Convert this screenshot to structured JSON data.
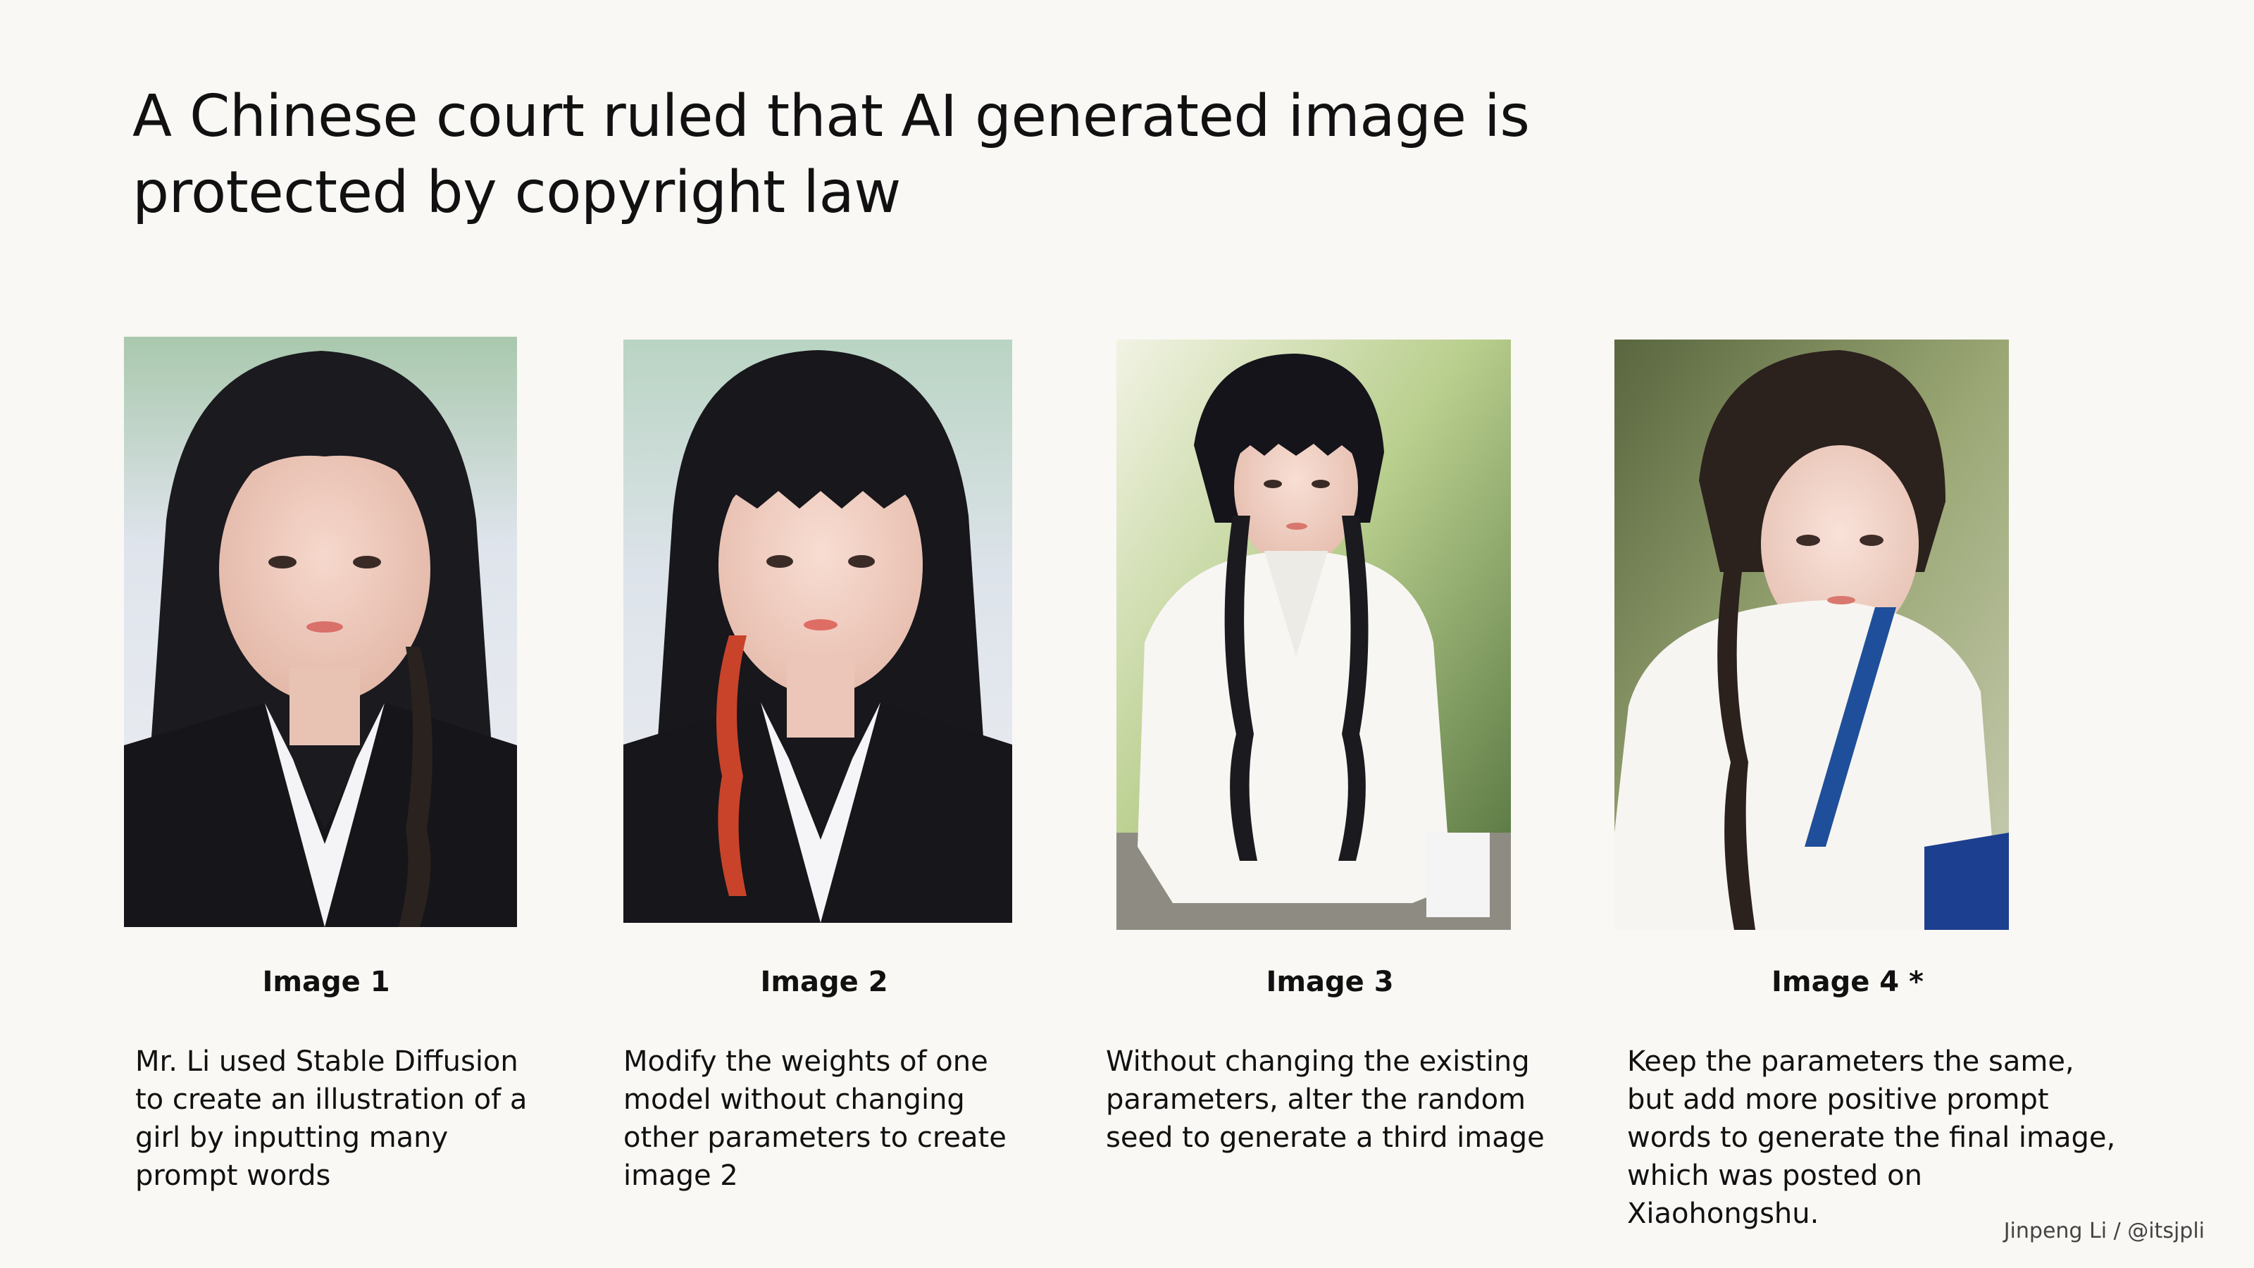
{
  "title": "A Chinese court ruled that AI generated image is protected by copyright law",
  "panels": [
    {
      "label": "Image 1",
      "description": "Mr. Li used Stable Diffusion\nto create an illustration of a\ngirl by inputting many\nprompt words"
    },
    {
      "label": "Image 2",
      "description": "Modify the weights of one\nmodel without changing\nother parameters to create\nimage 2"
    },
    {
      "label": "Image 3",
      "description": "Without changing the existing\nparameters, alter the random\nseed to generate a third image"
    },
    {
      "label": "Image 4 *",
      "description": "Keep the parameters the same,\nbut add more positive prompt\nwords to generate the final image,\nwhich was posted on\nXiaohongshu."
    }
  ],
  "credit": "Jinpeng Li / @itsjpli"
}
